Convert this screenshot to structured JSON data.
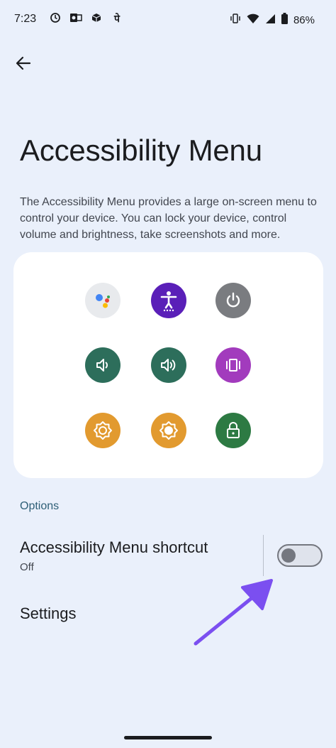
{
  "status_bar": {
    "time": "7:23",
    "battery": "86%",
    "left_icons": [
      "sync-icon",
      "outlook-icon",
      "box-icon",
      "pe-icon"
    ],
    "pe_glyph": "पे",
    "right_icons": [
      "vibrate-icon",
      "wifi-icon",
      "signal-icon",
      "battery-icon"
    ]
  },
  "header": {
    "title": "Accessibility Menu",
    "back_icon": "arrow-left-icon"
  },
  "description": "The Accessibility Menu provides a large on-screen menu to control your device. You can lock your device, control volume and brightness, take screenshots and more.",
  "preview": {
    "icons": [
      {
        "name": "assistant-icon",
        "color": "#e8eaed"
      },
      {
        "name": "accessibility-settings-icon",
        "color": "#5a1fb8"
      },
      {
        "name": "power-icon",
        "color": "#7a7c80"
      },
      {
        "name": "volume-down-icon",
        "color": "#2d6e5b"
      },
      {
        "name": "volume-up-icon",
        "color": "#2d6e5b"
      },
      {
        "name": "recent-apps-icon",
        "color": "#a23bbd"
      },
      {
        "name": "brightness-down-icon",
        "color": "#e29a2f"
      },
      {
        "name": "brightness-up-icon",
        "color": "#e29a2f"
      },
      {
        "name": "lock-screen-icon",
        "color": "#2d7a43"
      }
    ]
  },
  "options": {
    "section_label": "Options",
    "shortcut": {
      "title": "Accessibility Menu shortcut",
      "summary": "Off",
      "enabled": false
    },
    "settings_label": "Settings"
  },
  "colors": {
    "background": "#eaf0fb",
    "card": "#ffffff",
    "section_accent": "#2e5f77",
    "annotation_arrow": "#7b4ff0"
  }
}
